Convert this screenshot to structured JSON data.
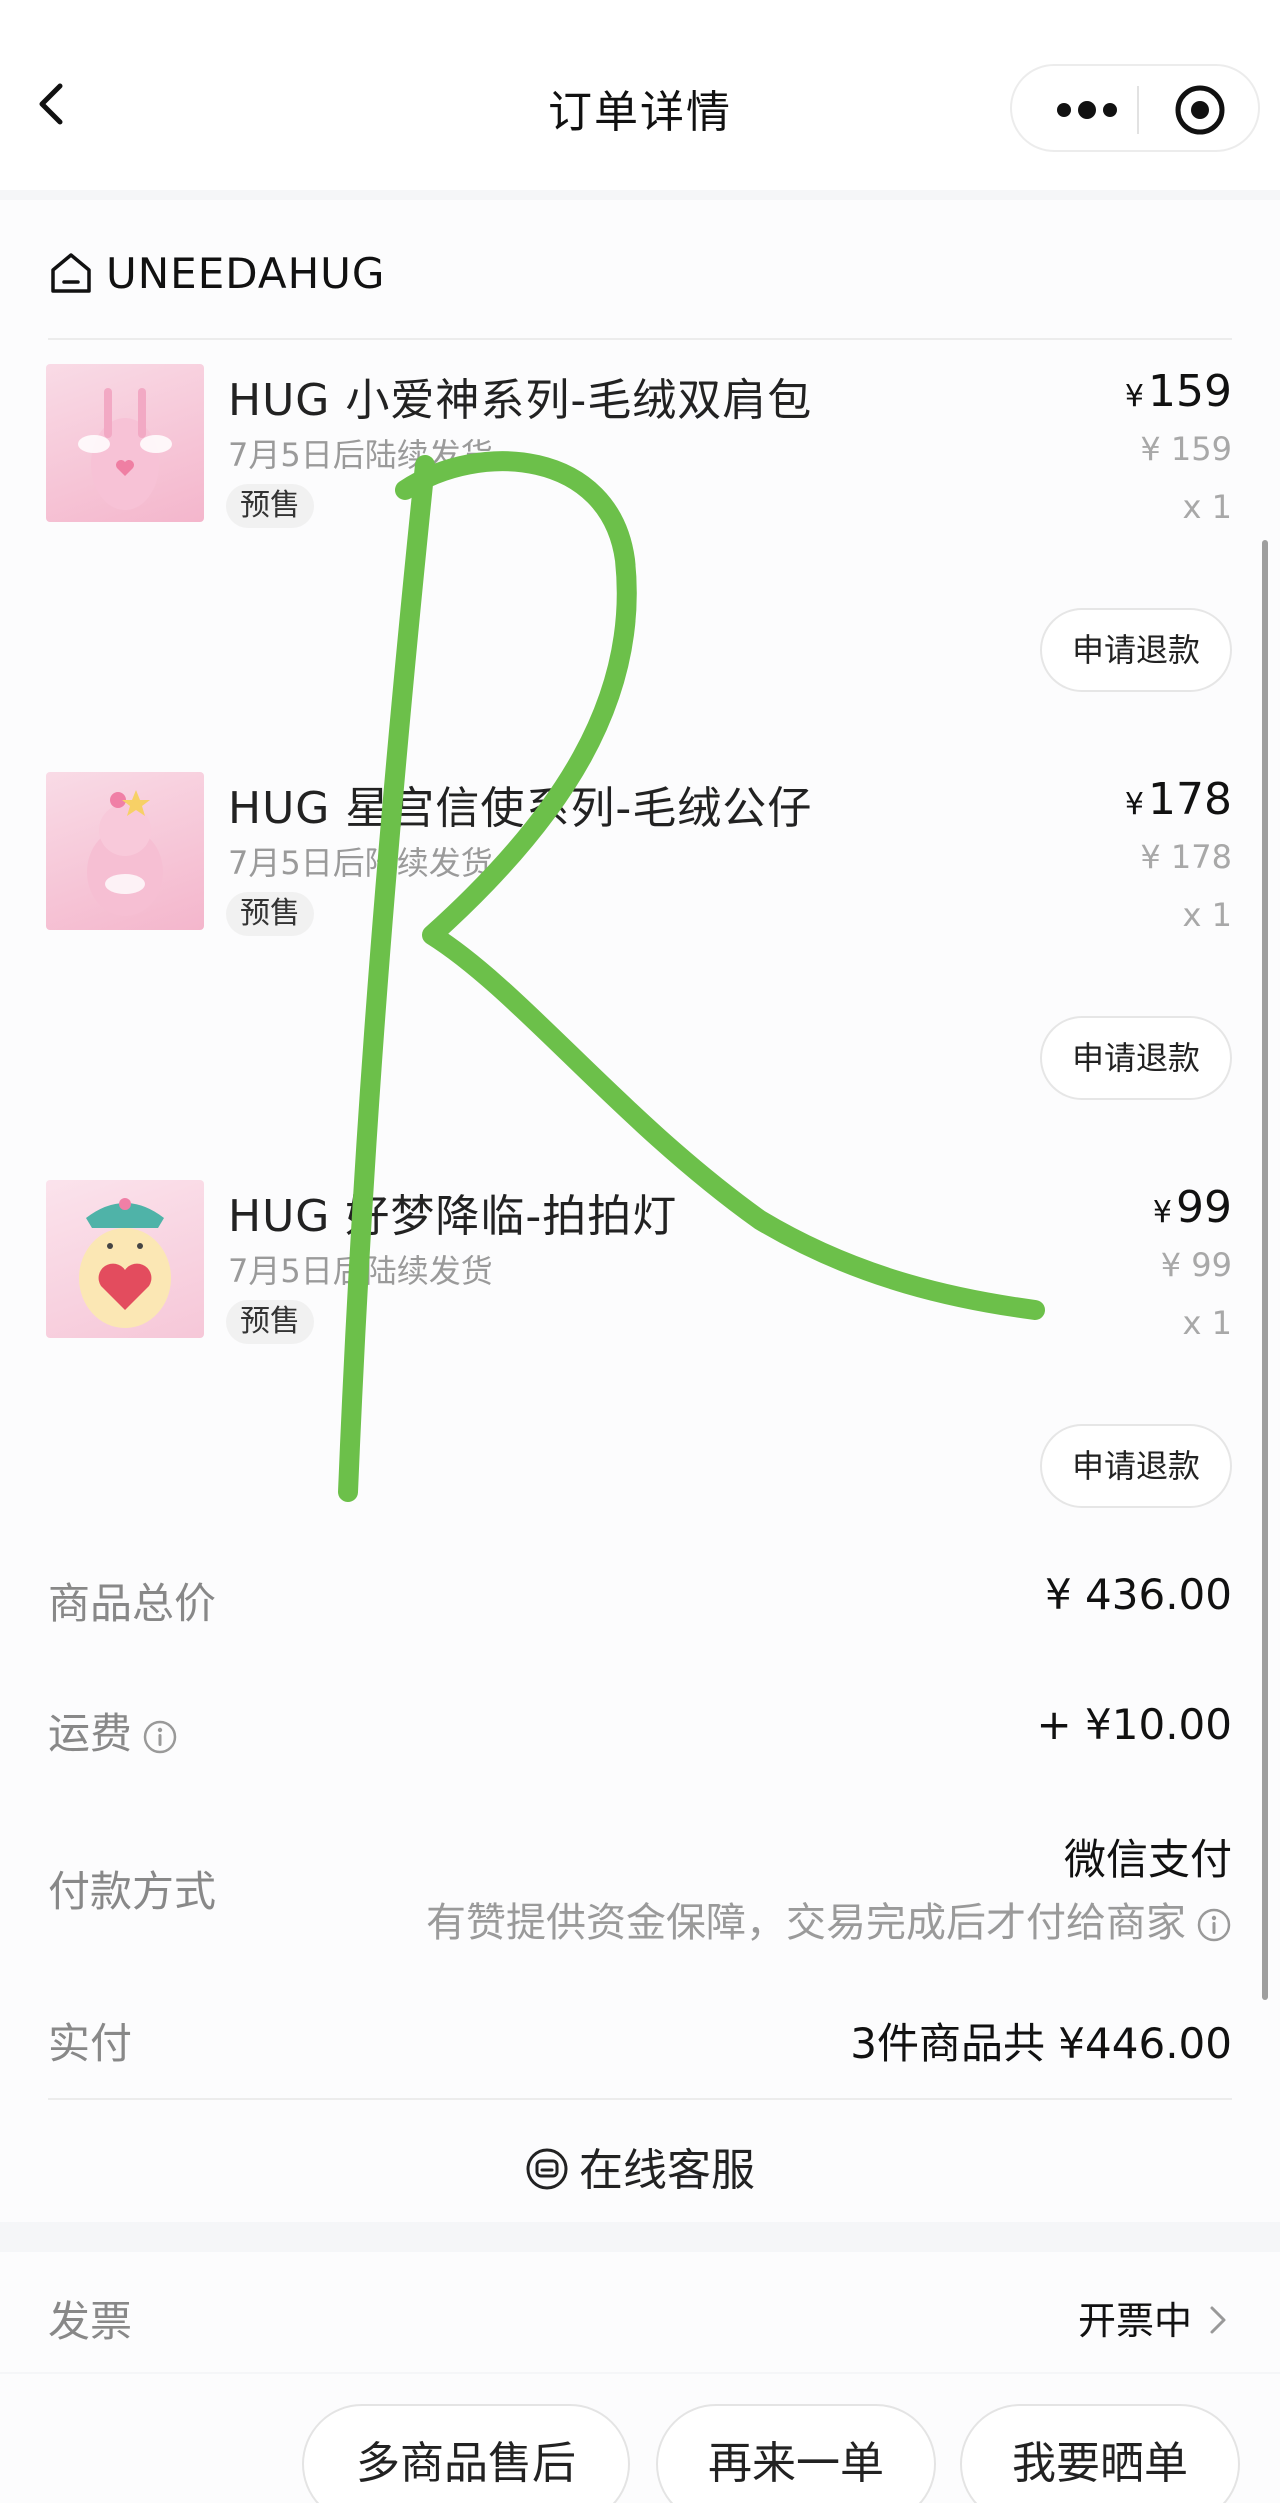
{
  "header": {
    "title": "订单详情"
  },
  "shop": {
    "name": "UNEEDAHUG"
  },
  "items": [
    {
      "name": "HUG 小爱神系列-毛绒双肩包",
      "ship_note": "7月5日后陆续发货",
      "tag": "预售",
      "price_symbol": "¥",
      "price": "159",
      "original_price": "¥ 159",
      "quantity": "x 1",
      "refund_label": "申请退款"
    },
    {
      "name": "HUG 星宫信使系列-毛绒公仔",
      "ship_note": "7月5日后陆续发货",
      "tag": "预售",
      "price_symbol": "¥",
      "price": "178",
      "original_price": "¥ 178",
      "quantity": "x 1",
      "refund_label": "申请退款"
    },
    {
      "name": "HUG 好梦降临-拍拍灯",
      "ship_note": "7月5日后陆续发货",
      "tag": "预售",
      "price_symbol": "¥",
      "price": "99",
      "original_price": "¥ 99",
      "quantity": "x 1",
      "refund_label": "申请退款"
    }
  ],
  "summary": {
    "goods_total_label": "商品总价",
    "goods_total_value": "¥ 436.00",
    "shipping_label": "运费",
    "shipping_value": "+ ¥10.00",
    "payment_label": "付款方式",
    "payment_value": "微信支付",
    "payment_note": "有赞提供资金保障，交易完成后才付给商家",
    "paid_label": "实付",
    "paid_value": "3件商品共 ¥446.00"
  },
  "service": {
    "label": "在线客服"
  },
  "invoice": {
    "label": "发票",
    "status": "开票中"
  },
  "bottom_buttons": {
    "after_sale": "多商品售后",
    "reorder": "再来一单",
    "share": "我要晒单"
  },
  "colors": {
    "scribble": "#6cc04a",
    "background": "#f5f6f8",
    "card": "#fcfcfd"
  }
}
